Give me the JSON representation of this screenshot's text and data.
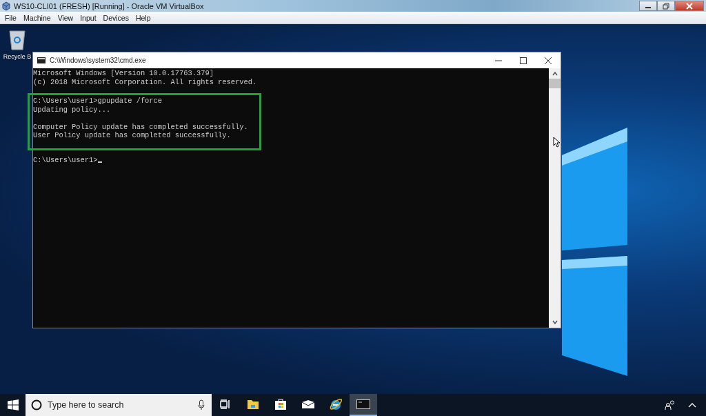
{
  "host_window": {
    "title": "WS10-CLI01 (FRESH) [Running] - Oracle VM VirtualBox",
    "menu": [
      "File",
      "Machine",
      "View",
      "Input",
      "Devices",
      "Help"
    ]
  },
  "desktop": {
    "icons": [
      {
        "label": "Recycle B"
      }
    ]
  },
  "cmd_window": {
    "title": "C:\\Windows\\system32\\cmd.exe",
    "blocks": [
      {
        "highlighted": false,
        "paragraphs": [
          [
            "Microsoft Windows [Version 10.0.17763.379]",
            "(c) 2018 Microsoft Corporation. All rights reserved."
          ]
        ]
      },
      {
        "highlighted": true,
        "paragraphs": [
          [
            "C:\\Users\\user1>gpupdate /force",
            "Updating policy..."
          ],
          [
            "Computer Policy update has completed successfully.",
            "User Policy update has completed successfully."
          ]
        ]
      }
    ],
    "prompt": "C:\\Users\\user1>"
  },
  "taskbar": {
    "search": {
      "placeholder": "Type here to search"
    },
    "apps": [
      {
        "kind": "task-view",
        "active": false
      },
      {
        "kind": "folder",
        "active": false
      },
      {
        "kind": "store",
        "active": false
      },
      {
        "kind": "mail",
        "active": false
      },
      {
        "kind": "browser",
        "active": false
      },
      {
        "kind": "terminal",
        "active": true
      }
    ]
  }
}
